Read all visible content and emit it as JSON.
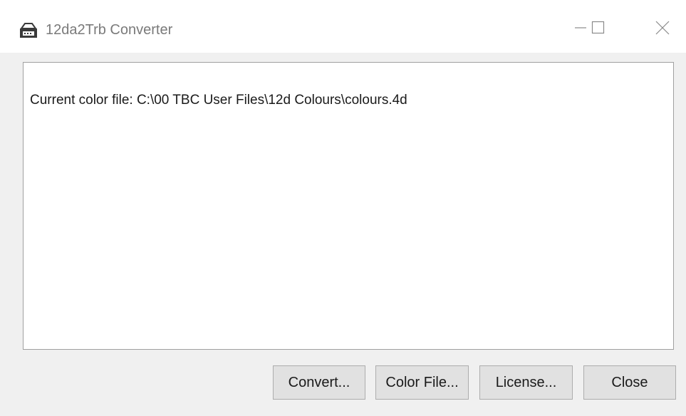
{
  "window": {
    "title": "12da2Trb Converter",
    "icon": "app-icon"
  },
  "caption_buttons": {
    "minimize_icon": "minimize-icon",
    "maximize_icon": "maximize-icon",
    "close_icon": "close-icon"
  },
  "output": {
    "lines": [
      "Current color file: C:\\00 TBC User Files\\12d Colours\\colours.4d"
    ]
  },
  "buttons": {
    "convert": "Convert...",
    "color_file": "Color File...",
    "license": "License...",
    "close": "Close"
  },
  "colors": {
    "window_bg": "#f0f0f0",
    "button_bg": "#e1e1e1",
    "button_border": "#adadad"
  }
}
